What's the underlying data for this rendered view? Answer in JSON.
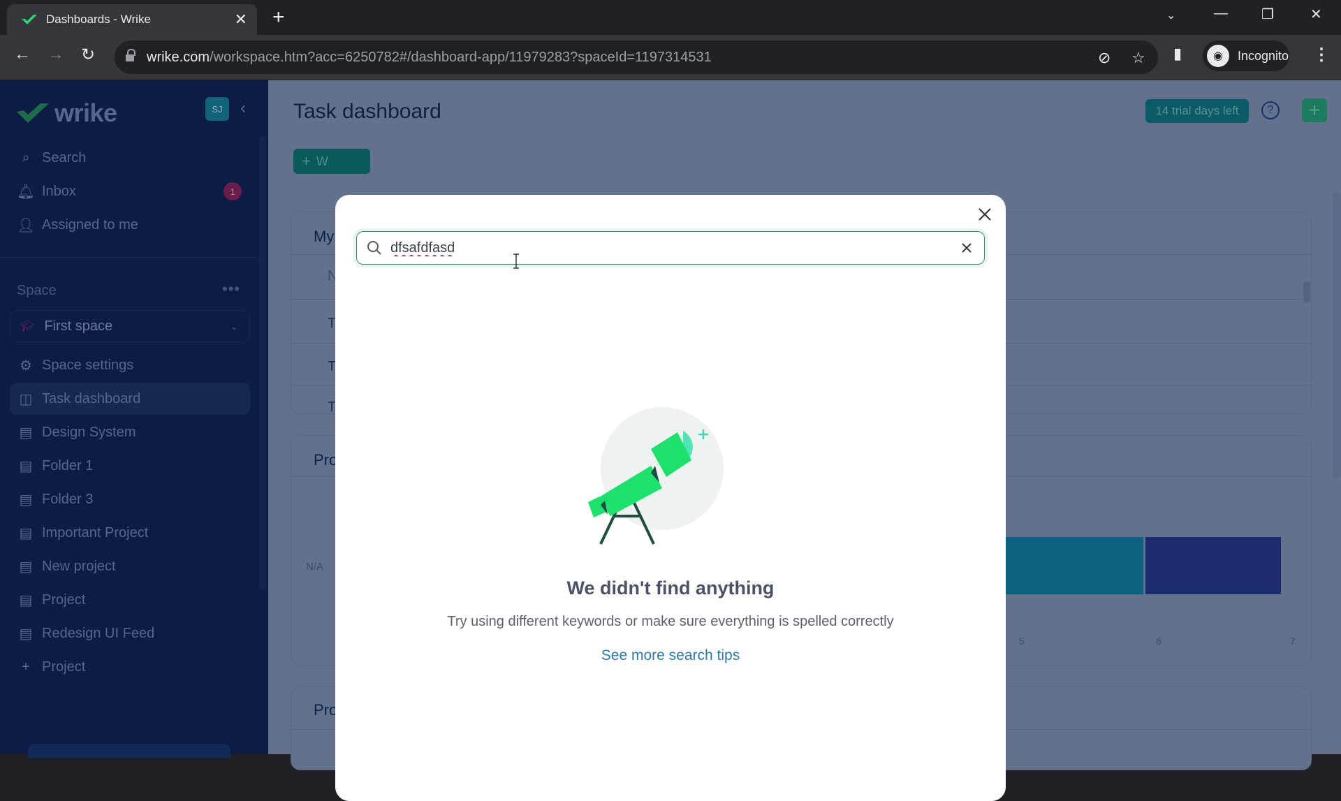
{
  "browser": {
    "tab_title": "Dashboards - Wrike",
    "url_host": "wrike.com",
    "url_path": "/workspace.htm?acc=6250782#/dashboard-app/11979283?spaceId=1197314531",
    "profile_label": "Incognito"
  },
  "app": {
    "logo_text": "wrike",
    "user_initials": "SJ",
    "nav": [
      {
        "label": "Search",
        "icon": "search-icon"
      },
      {
        "label": "Inbox",
        "icon": "bell-icon",
        "badge": "1"
      },
      {
        "label": "Assigned to me",
        "icon": "assigned-icon"
      }
    ],
    "space_section_label": "Space",
    "space_more": "•••",
    "current_space": "First space",
    "space_items": [
      {
        "label": "Space settings",
        "icon": "gear-icon"
      },
      {
        "label": "Task dashboard",
        "icon": "dashboard-icon",
        "active": true
      },
      {
        "label": "Design System",
        "icon": "clipboard-icon"
      },
      {
        "label": "Folder 1",
        "icon": "clipboard-icon"
      },
      {
        "label": "Folder 3",
        "icon": "clipboard-icon"
      },
      {
        "label": "Important Project",
        "icon": "clipboard-icon"
      },
      {
        "label": "New project",
        "icon": "clipboard-icon"
      },
      {
        "label": "Project",
        "icon": "clipboard-icon"
      },
      {
        "label": "Redesign UI Feed",
        "icon": "clipboard-icon"
      }
    ],
    "add_project_label": "Project"
  },
  "dashboard": {
    "title": "Task dashboard",
    "trial_label": "14 trial days left",
    "help_label": "?",
    "add_widget_label": "W",
    "widgets": [
      {
        "title": "My",
        "rows": [
          "N",
          "T",
          "T",
          "T"
        ]
      },
      {
        "title": "Pro",
        "na_label": "N/A",
        "axis_ticks": [
          "5",
          "6",
          "7"
        ]
      },
      {
        "title": "Pro"
      }
    ],
    "bar_colors": [
      "#0b6180",
      "#1c2c6f"
    ]
  },
  "search_modal": {
    "query": "dfsafdfasd",
    "empty_title": "We didn't find anything",
    "empty_subtitle": "Try using different keywords or make sure everything is spelled correctly",
    "tips_link": "See more search tips"
  },
  "colors": {
    "accent_green": "#1de06d",
    "search_border": "#3d8b73",
    "link": "#2a79a8"
  }
}
